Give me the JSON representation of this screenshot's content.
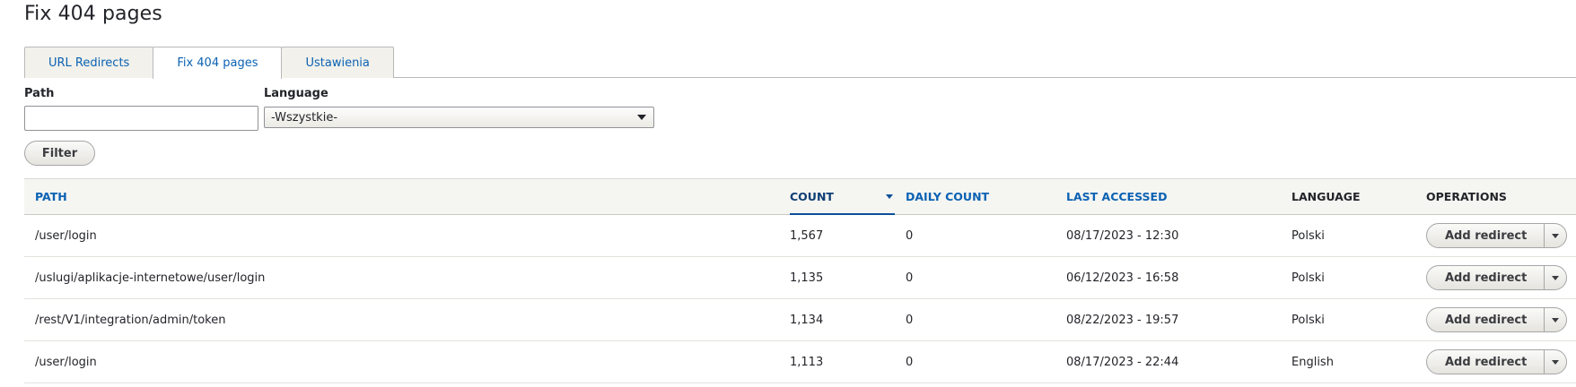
{
  "page": {
    "title": "Fix 404 pages"
  },
  "tabs": [
    {
      "label": "URL Redirects",
      "active": false
    },
    {
      "label": "Fix 404 pages",
      "active": true
    },
    {
      "label": "Ustawienia",
      "active": false
    }
  ],
  "filters": {
    "path_label": "Path",
    "path_value": "",
    "language_label": "Language",
    "language_value": "-Wszystkie-",
    "filter_button": "Filter"
  },
  "table": {
    "headers": {
      "path": "Path",
      "count": "Count",
      "daily_count": "Daily count",
      "last_accessed": "Last accessed",
      "language": "Language",
      "operations": "Operations"
    },
    "sorted_by": "count",
    "sort_direction": "desc",
    "rows": [
      {
        "path": "/user/login",
        "count": "1,567",
        "daily_count": "0",
        "last_accessed": "08/17/2023 - 12:30",
        "language": "Polski",
        "operation": "Add redirect"
      },
      {
        "path": "/uslugi/aplikacje-internetowe/user/login",
        "count": "1,135",
        "daily_count": "0",
        "last_accessed": "06/12/2023 - 16:58",
        "language": "Polski",
        "operation": "Add redirect"
      },
      {
        "path": "/rest/V1/integration/admin/token",
        "count": "1,134",
        "daily_count": "0",
        "last_accessed": "08/22/2023 - 19:57",
        "language": "Polski",
        "operation": "Add redirect"
      },
      {
        "path": "/user/login",
        "count": "1,113",
        "daily_count": "0",
        "last_accessed": "08/17/2023 - 22:44",
        "language": "English",
        "operation": "Add redirect"
      }
    ]
  },
  "colors": {
    "link": "#0b62b3",
    "sorted_header": "#0d3e74",
    "header_bg": "#f5f5f2"
  }
}
